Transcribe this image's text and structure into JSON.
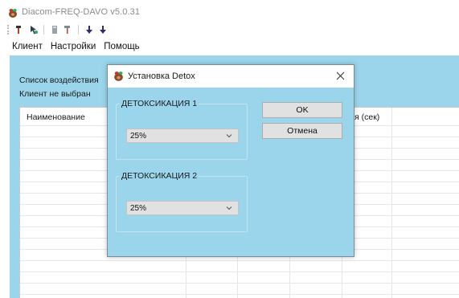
{
  "window": {
    "title": "Diacom-FREQ-DAVO v5.0.31",
    "icon": "app-logo-icon"
  },
  "toolbar": {
    "buttons": [
      {
        "icon": "probe-icon"
      },
      {
        "icon": "pointer-icon"
      },
      {
        "icon": "tool-icon"
      },
      {
        "icon": "arrow-down-1-icon"
      },
      {
        "icon": "arrow-down-2-icon"
      }
    ]
  },
  "menu": {
    "client": "Клиент",
    "settings": "Настройки",
    "help": "Помощь"
  },
  "main": {
    "list_label": "Список воздействия",
    "client_status": "Клиент не выбран",
    "columns": {
      "name": "Наименование",
      "time": "я (сек)"
    }
  },
  "dialog": {
    "title": "Установка Detox",
    "group1": {
      "legend": "ДЕТОКСИКАЦИЯ 1",
      "selected": "25%"
    },
    "group2": {
      "legend": "ДЕТОКСИКАЦИЯ 2",
      "selected": "25%"
    },
    "ok_label": "OK",
    "cancel_label": "Отмена"
  },
  "colors": {
    "panel_bg": "#9bd5ec",
    "button_bg": "#e1e1e1",
    "accent_red": "#c0392b"
  }
}
